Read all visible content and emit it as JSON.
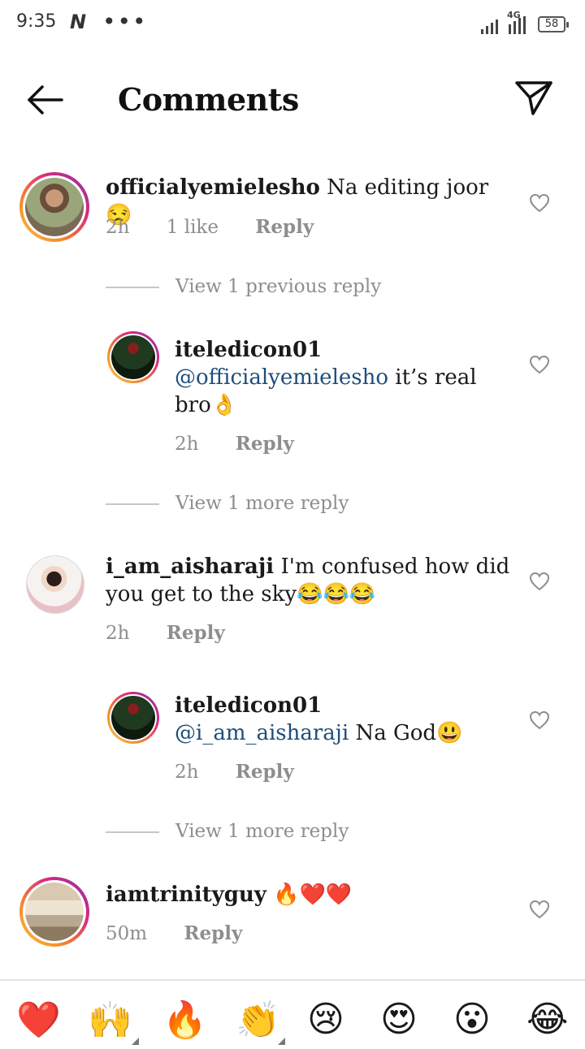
{
  "status_bar": {
    "time": "9:35",
    "app_badge": "N",
    "dots": "•••",
    "network": "4G",
    "battery": "58"
  },
  "header": {
    "title": "Comments"
  },
  "comments": [
    {
      "username": "officialyemielesho",
      "text": "Na editing joor 😒",
      "time": "2h",
      "likes": "1 like",
      "reply": "Reply",
      "view_replies": "View 1 previous reply"
    },
    {
      "username": "iteledicon01",
      "mention": "@officialyemielesho",
      "text_line1": " it’s real",
      "text_line2": "bro👌",
      "time": "2h",
      "reply": "Reply",
      "view_replies": "View 1 more reply"
    },
    {
      "username": "i_am_aisharaji",
      "text_line1": " I'm confused how did",
      "text_line2": "you get to the sky😂😂😂",
      "time": "2h",
      "reply": "Reply"
    },
    {
      "username": "iteledicon01",
      "mention": "@i_am_aisharaji",
      "text": " Na God😃",
      "time": "2h",
      "reply": "Reply",
      "view_replies": "View 1 more reply"
    },
    {
      "username": "iamtrinityguy",
      "text": " 🔥❤️❤️",
      "time": "50m",
      "reply": "Reply"
    }
  ],
  "emoji_bar": [
    "❤️",
    "🙌",
    "🔥",
    "👏",
    "😢",
    "😍",
    "😮",
    "😂"
  ],
  "colors": {
    "mention": "#1e4d7a",
    "meta": "#8e8e8e",
    "story_ring": [
      "#f7c948",
      "#f58529",
      "#dd2a7b",
      "#8134af"
    ]
  }
}
